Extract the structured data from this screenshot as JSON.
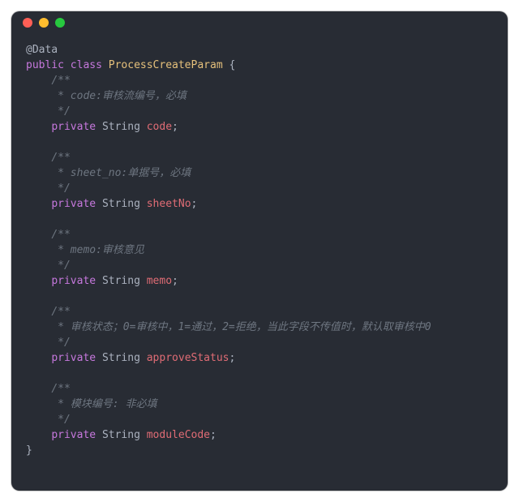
{
  "code": {
    "annotation": "@Data",
    "kw_public": "public",
    "kw_class": "class",
    "class_name": "ProcessCreateParam",
    "brace_open": "{",
    "brace_close": "}",
    "kw_private": "private",
    "type_string": "String",
    "cmt_open": "/**",
    "cmt_close": " */",
    "fields": {
      "f1_cmt": " * code:审核流编号，必填",
      "f1_name": "code",
      "f2_cmt": " * sheet_no:单据号，必填",
      "f2_name": "sheetNo",
      "f3_cmt": " * memo:审核意见",
      "f3_name": "memo",
      "f4_cmt": " * 审核状态；0=审核中，1=通过，2=拒绝，当此字段不传值时，默认取审核中0",
      "f4_name": "approveStatus",
      "f5_cmt": " * 模块编号: 非必填",
      "f5_name": "moduleCode"
    }
  }
}
